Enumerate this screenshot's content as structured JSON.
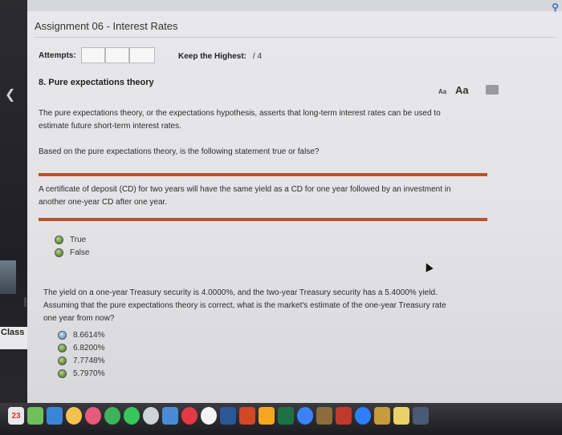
{
  "window": {
    "title": "Assignment 06 - Interest Rates"
  },
  "left_panel": {
    "class_label": "Class"
  },
  "header": {
    "attempts_label": "Attempts:",
    "keep_highest_label": "Keep the Highest:",
    "keep_highest_value": "/ 4"
  },
  "question": {
    "title": "8. Pure expectations theory",
    "font_small": "Aa",
    "font_large": "Aa",
    "intro_line1": "The pure expectations theory, or the expectations hypothesis, asserts that long-term interest rates can be used to",
    "intro_line2": "estimate future short-term interest rates.",
    "prompt": "Based on the pure expectations theory, is the following statement true or false?",
    "statement_line1": "A certificate of deposit (CD) for two years will have the same yield as a CD for one year followed by an investment in",
    "statement_line2": "another one-year CD after one year.",
    "tf_options": [
      "True",
      "False"
    ],
    "q2_line1": "The yield on a one-year Treasury security is 4.0000%, and the two-year Treasury security has a 5.4000% yield.",
    "q2_line2": "Assuming that the pure expectations theory is correct, what is the market's estimate of the one-year Treasury rate",
    "q2_line3": "one year from now?",
    "rate_options": [
      "8.6614%",
      "6.8200%",
      "7.7748%",
      "5.7970%"
    ]
  },
  "taskbar": {
    "calendar_day": "23"
  },
  "colors": {
    "accent_rule": "#b5532e",
    "radio_green": "#5f8a36",
    "radio_blue": "#6f9cc8"
  }
}
